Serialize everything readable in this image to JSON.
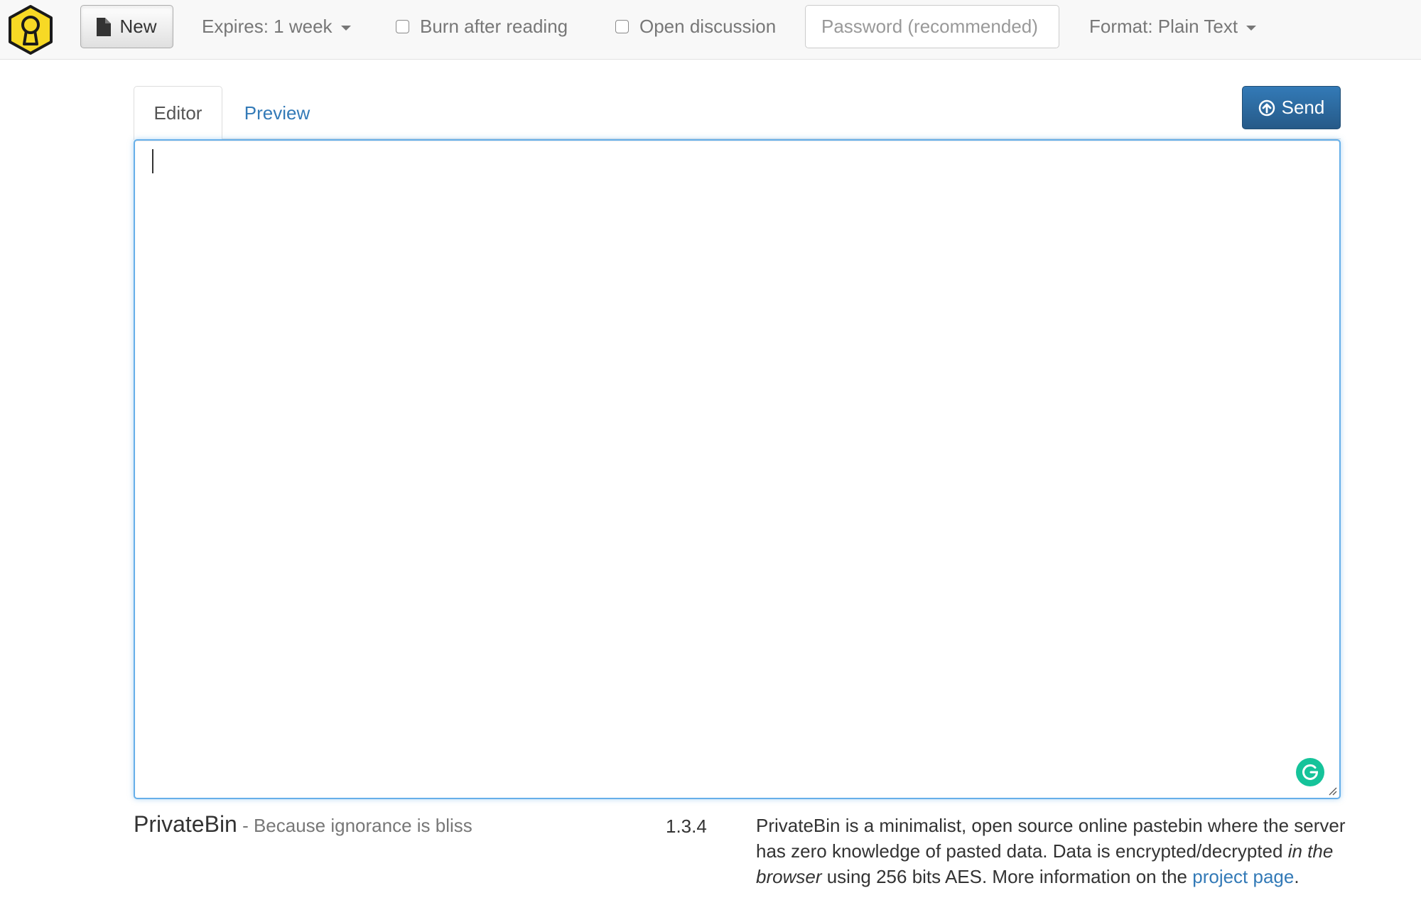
{
  "navbar": {
    "new_label": "New",
    "expires_label": "Expires: 1 week",
    "burn_label": "Burn after reading",
    "discussion_label": "Open discussion",
    "password_placeholder": "Password (recommended)",
    "password_value": "",
    "format_label": "Format: Plain Text"
  },
  "tabs": {
    "editor_label": "Editor",
    "preview_label": "Preview"
  },
  "send_label": "Send",
  "editor": {
    "value": ""
  },
  "footer": {
    "brand": "PrivateBin",
    "tagline": " - Because ignorance is bliss",
    "version": "1.3.4",
    "about_part1": "PrivateBin is a minimalist, open source online pastebin where the server has zero knowledge of pasted data. Data is encrypted/decrypted ",
    "about_em1": "in the browser",
    "about_part2": " using 256 bits AES. More information on the ",
    "about_link": "project page",
    "about_part3": "."
  },
  "icons": {
    "logo": "keyhole-logo-icon",
    "new": "file-icon",
    "send": "circle-arrow-up-icon",
    "grammarly": "grammarly-icon"
  },
  "colors": {
    "link": "#337ab7",
    "send_button": "#337ab7",
    "logo": "#f7d925",
    "editor_focus": "#66afe9",
    "grammarly": "#15c39a"
  }
}
